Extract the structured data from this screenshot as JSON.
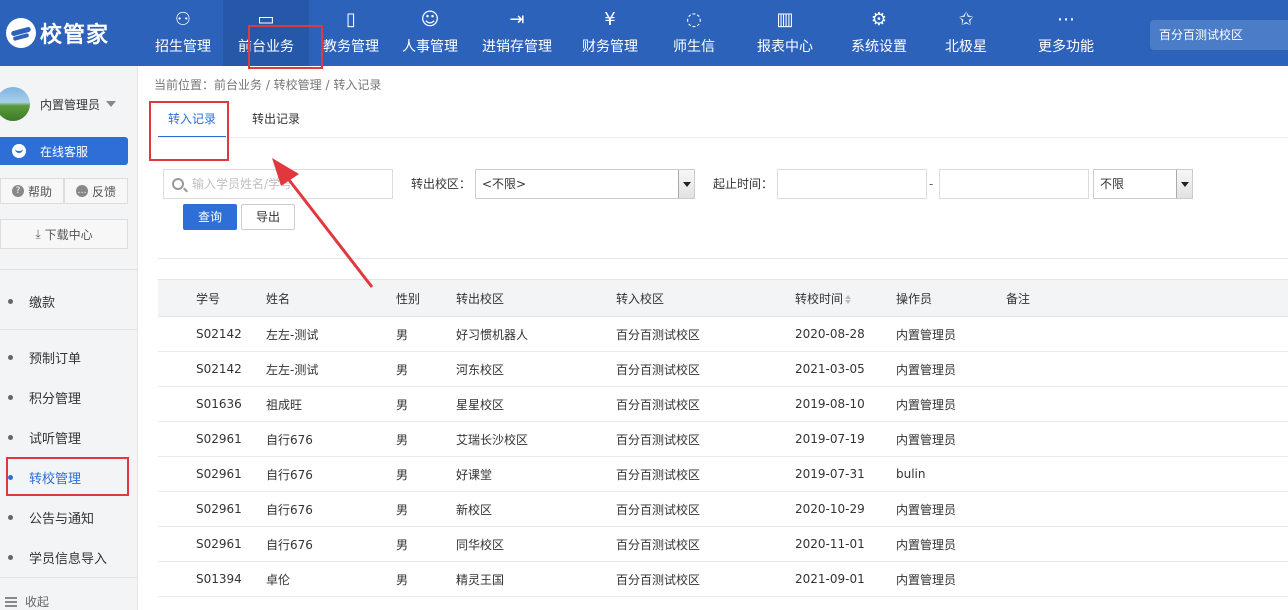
{
  "app": {
    "logo_text": "校管家"
  },
  "nav": {
    "items": [
      {
        "label": "招生管理",
        "icon": "user-add-icon"
      },
      {
        "label": "前台业务",
        "icon": "desk-icon"
      },
      {
        "label": "教务管理",
        "icon": "book-icon"
      },
      {
        "label": "人事管理",
        "icon": "person-icon"
      },
      {
        "label": "进销存管理",
        "icon": "inventory-icon"
      },
      {
        "label": "财务管理",
        "icon": "finance-icon"
      },
      {
        "label": "师生信",
        "icon": "message-icon"
      },
      {
        "label": "报表中心",
        "icon": "report-icon"
      },
      {
        "label": "系统设置",
        "icon": "settings-icon"
      },
      {
        "label": "北极星",
        "icon": "star-icon"
      },
      {
        "label": "更多功能",
        "icon": "more-icon"
      }
    ],
    "active_index": 1,
    "campus": "百分百测试校区"
  },
  "sidebar": {
    "user_name": "内置管理员",
    "service_label": "在线客服",
    "help_label": "帮助",
    "feedback_label": "反馈",
    "download_label": "下载中心",
    "items": [
      {
        "label": "缴款"
      },
      {
        "label": "预制订单"
      },
      {
        "label": "积分管理"
      },
      {
        "label": "试听管理"
      },
      {
        "label": "转校管理"
      },
      {
        "label": "公告与通知"
      },
      {
        "label": "学员信息导入"
      }
    ],
    "active_index": 4,
    "collapse_label": "收起"
  },
  "main": {
    "breadcrumb": "当前位置：前台业务 / 转校管理 / 转入记录",
    "tabs": [
      {
        "label": "转入记录"
      },
      {
        "label": "转出记录"
      }
    ],
    "active_tab": 0,
    "filters": {
      "search_placeholder": "输入学员姓名/学号",
      "from_campus_label": "转出校区：",
      "from_campus_value": "<不限>",
      "date_label": "起止时间：",
      "date_separator": "-",
      "range_value": "不限"
    },
    "buttons": {
      "query": "查询",
      "export": "导出"
    },
    "table": {
      "headers": [
        "学号",
        "姓名",
        "性别",
        "转出校区",
        "转入校区",
        "转校时间",
        "操作员",
        "备注"
      ],
      "rows": [
        [
          "S02142",
          "左左-测试",
          "男",
          "好习惯机器人",
          "百分百测试校区",
          "2020-08-28",
          "内置管理员",
          ""
        ],
        [
          "S02142",
          "左左-测试",
          "男",
          "河东校区",
          "百分百测试校区",
          "2021-03-05",
          "内置管理员",
          ""
        ],
        [
          "S01636",
          "祖成旺",
          "男",
          "星星校区",
          "百分百测试校区",
          "2019-08-10",
          "内置管理员",
          ""
        ],
        [
          "S02961",
          "自行676",
          "男",
          "艾瑞长沙校区",
          "百分百测试校区",
          "2019-07-19",
          "内置管理员",
          ""
        ],
        [
          "S02961",
          "自行676",
          "男",
          "好课堂",
          "百分百测试校区",
          "2019-07-31",
          "bulin",
          ""
        ],
        [
          "S02961",
          "自行676",
          "男",
          "新校区",
          "百分百测试校区",
          "2020-10-29",
          "内置管理员",
          ""
        ],
        [
          "S02961",
          "自行676",
          "男",
          "同华校区",
          "百分百测试校区",
          "2020-11-01",
          "内置管理员",
          ""
        ],
        [
          "S01394",
          "卓伦",
          "男",
          "精灵王国",
          "百分百测试校区",
          "2021-09-01",
          "内置管理员",
          ""
        ]
      ]
    }
  },
  "colors": {
    "brand": "#2d62ba",
    "accent": "#2d6fd6",
    "highlight": "#e0383e"
  }
}
